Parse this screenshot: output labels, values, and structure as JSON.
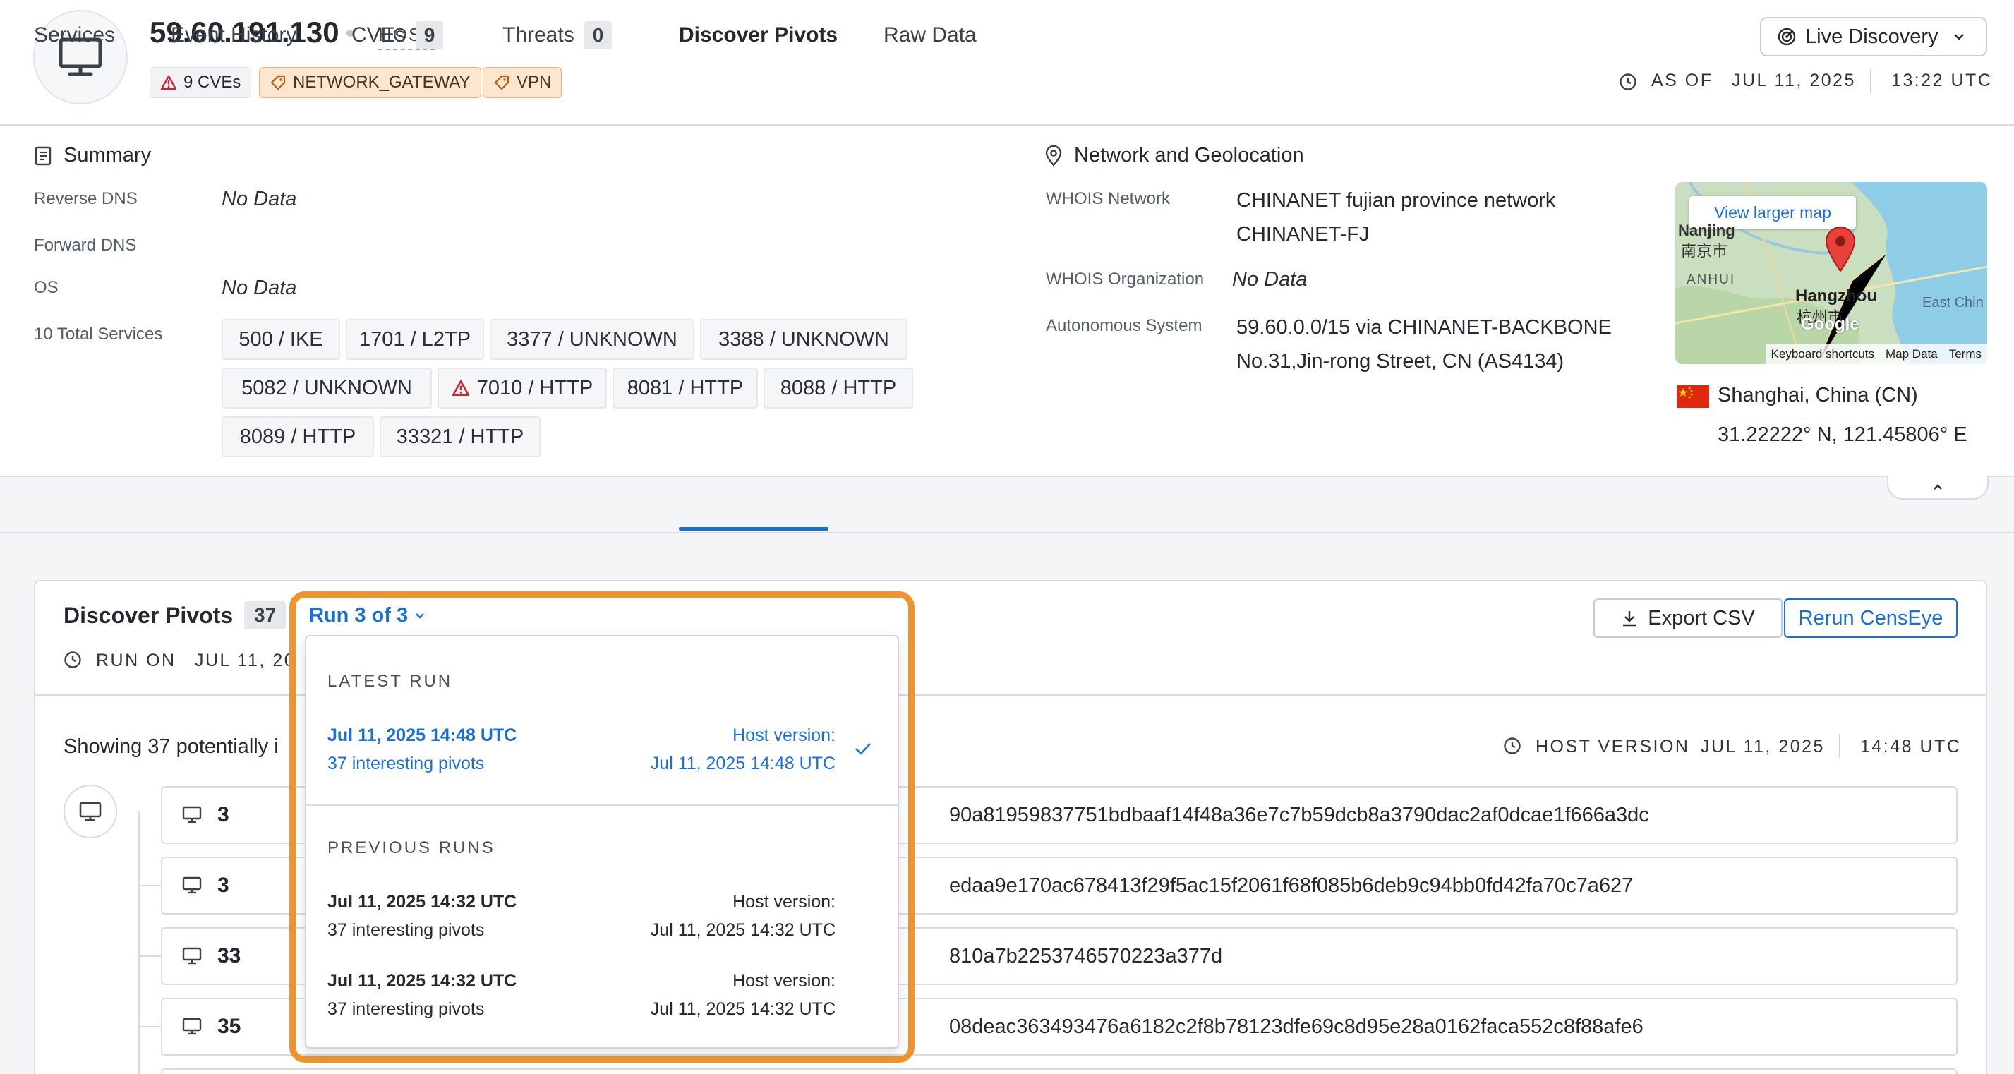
{
  "header": {
    "ip": "59.60.191.130",
    "host_type": "HOST",
    "tags": {
      "cves": "9 CVEs",
      "gateway": "NETWORK_GATEWAY",
      "vpn": "VPN"
    },
    "live_discovery": "Live Discovery",
    "as_of_label": "AS OF",
    "as_of_date": "JUL 11, 2025",
    "as_of_time": "13:22 UTC"
  },
  "summary": {
    "title": "Summary",
    "reverse_dns_label": "Reverse DNS",
    "reverse_dns_value": "No Data",
    "forward_dns_label": "Forward DNS",
    "os_label": "OS",
    "os_value": "No Data",
    "services_label": "10 Total Services",
    "services": [
      "500 / IKE",
      "1701 / L2TP",
      "3377 / UNKNOWN",
      "3388 / UNKNOWN",
      "5082 / UNKNOWN",
      "7010 / HTTP",
      "8081 / HTTP",
      "8088 / HTTP",
      "8089 / HTTP",
      "33321 / HTTP"
    ]
  },
  "network": {
    "title": "Network and Geolocation",
    "whois_network_label": "WHOIS Network",
    "whois_network_line1": "CHINANET fujian province network",
    "whois_network_line2": "CHINANET-FJ",
    "whois_org_label": "WHOIS Organization",
    "whois_org_value": "No Data",
    "as_label": "Autonomous System",
    "as_line1": "59.60.0.0/15 via CHINANET-BACKBONE",
    "as_line2": "No.31,Jin-rong Street, CN (AS4134)",
    "map": {
      "view_larger": "View larger map",
      "city_nanjing_en": "Nanjing",
      "city_nanjing_zh": "南京市",
      "region_anhui": "ANHUI",
      "city_hangzhou_en": "Hangzhou",
      "city_hangzhou_zh": "杭州市",
      "east_china": "East Chin",
      "google": "Google",
      "footer_shortcuts": "Keyboard shortcuts",
      "footer_mapdata": "Map Data",
      "footer_terms": "Terms"
    },
    "location": "Shanghai, China (CN)",
    "coords": "31.22222° N, 121.45806° E"
  },
  "tabs": {
    "services": "Services",
    "event_history": "Event History",
    "cves": "CVEs",
    "cves_count": "9",
    "threats": "Threats",
    "threats_count": "0",
    "discover_pivots": "Discover Pivots",
    "raw_data": "Raw Data"
  },
  "pivots": {
    "title": "Discover Pivots",
    "count": "37",
    "run_selector": "Run 3 of 3",
    "run_on_label": "RUN ON",
    "run_on_date_partial": "JUL 11, 20",
    "showing_partial": "Showing 37 potentially i",
    "host_version_label": "HOST VERSION",
    "host_version_date": "JUL 11, 2025",
    "host_version_time": "14:48 UTC",
    "export_csv": "Export CSV",
    "rerun": "Rerun CensEye",
    "rows": [
      {
        "count": "3",
        "hash": "90a81959837751bdbaaf14f48a36e7c7b59dcb8a3790dac2af0dcae1f666a3dc"
      },
      {
        "count": "3",
        "hash": "edaa9e170ac678413f29f5ac15f2061f68f085b6deb9c94bb0fd42fa70c7a627"
      },
      {
        "count": "33",
        "hash": "810a7b2253746570223a377d"
      },
      {
        "count": "35",
        "hash": "08deac363493476a6182c2f8b78123dfe69c8d95e28a0162faca552c8f88afe6"
      }
    ]
  },
  "dropdown": {
    "latest_header": "LATEST RUN",
    "previous_header": "PREVIOUS RUNS",
    "latest": {
      "date": "Jul 11, 2025 14:48 UTC",
      "sub": "37 interesting pivots",
      "hv_label": "Host version:",
      "hv_date": "Jul 11, 2025 14:48 UTC"
    },
    "previous": [
      {
        "date": "Jul 11, 2025 14:32 UTC",
        "sub": "37 interesting pivots",
        "hv_label": "Host version:",
        "hv_date": "Jul 11, 2025 14:32 UTC"
      },
      {
        "date": "Jul 11, 2025 14:32 UTC",
        "sub": "37 interesting pivots",
        "hv_label": "Host version:",
        "hv_date": "Jul 11, 2025 14:32 UTC"
      }
    ]
  },
  "colors": {
    "accent": "#1a6fd6",
    "highlight": "#ef942c",
    "tag_orange_bg": "#fde6cf",
    "warning_red": "#d1242f"
  }
}
